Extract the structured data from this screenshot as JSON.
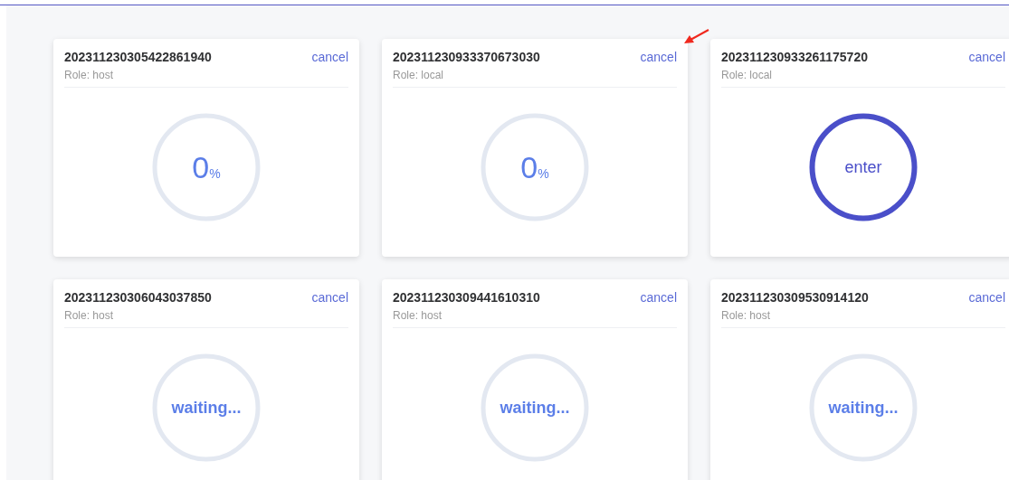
{
  "tasks": [
    {
      "id": "202311230305422861940",
      "role": "Role: host",
      "cancel": "cancel",
      "kind": "progress",
      "value": "0",
      "unit": "%"
    },
    {
      "id": "202311230933370673030",
      "role": "Role: local",
      "cancel": "cancel",
      "kind": "progress",
      "value": "0",
      "unit": "%"
    },
    {
      "id": "202311230933261175720",
      "role": "Role: local",
      "cancel": "cancel",
      "kind": "enter",
      "label": "enter"
    },
    {
      "id": "202311230306043037850",
      "role": "Role: host",
      "cancel": "cancel",
      "kind": "waiting",
      "label": "waiting..."
    },
    {
      "id": "202311230309441610310",
      "role": "Role: host",
      "cancel": "cancel",
      "kind": "waiting",
      "label": "waiting..."
    },
    {
      "id": "202311230309530914120",
      "role": "Role: host",
      "cancel": "cancel",
      "kind": "waiting",
      "label": "waiting..."
    }
  ]
}
